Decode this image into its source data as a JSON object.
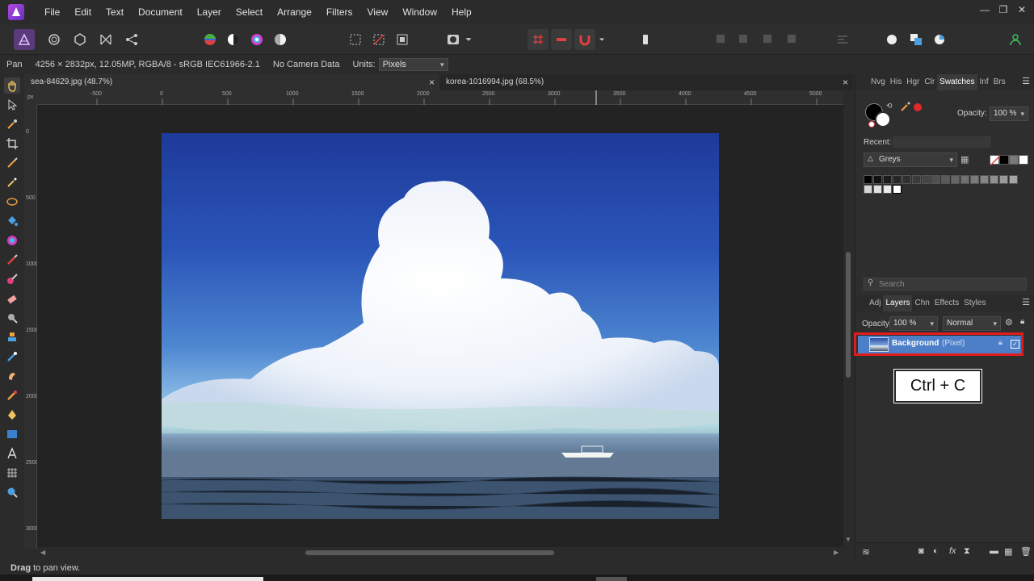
{
  "app": {
    "menu": [
      "File",
      "Edit",
      "Text",
      "Document",
      "Layer",
      "Select",
      "Arrange",
      "Filters",
      "View",
      "Window",
      "Help"
    ]
  },
  "window_controls": {
    "minimize": "—",
    "restore": "❐",
    "close": "✕"
  },
  "contextbar": {
    "tool": "Pan",
    "doc_info": "4256 × 2832px, 12.05MP, RGBA/8 - sRGB IEC61966-2.1",
    "camera": "No Camera Data",
    "units_label": "Units:",
    "units_value": "Pixels"
  },
  "tabs": [
    {
      "label": "sea-84629.jpg (48.7%)",
      "close": "×"
    },
    {
      "label": "korea-1016994.jpg (68.5%)",
      "close": "×"
    }
  ],
  "ruler": {
    "unit": "px",
    "top_ticks": [
      "-500",
      "0",
      "500",
      "1000",
      "1500",
      "2000",
      "2500",
      "3000",
      "3500",
      "4000",
      "4500",
      "5000"
    ],
    "left_ticks": [
      "0",
      "500",
      "1000",
      "1500",
      "2000",
      "2500",
      "3000"
    ]
  },
  "panel_top": {
    "tabs": [
      "Nvg",
      "His",
      "Hgr",
      "Clr",
      "Swatches",
      "Inf",
      "Brs"
    ],
    "active": "Swatches",
    "opacity_label": "Opacity:",
    "opacity_value": "100 %",
    "recent_label": "Recent:",
    "palette": "Greys"
  },
  "search": {
    "placeholder": "Search"
  },
  "panel_layers": {
    "tabs": [
      "Adj",
      "Layers",
      "Chn",
      "Effects",
      "Styles"
    ],
    "active": "Layers",
    "opacity_label": "Opacity:",
    "opacity_value": "100 %",
    "blend_mode": "Normal",
    "layer_name": "Background",
    "layer_type": "(Pixel)"
  },
  "overlay": {
    "shortcut": "Ctrl + C",
    "highlight_color": "#e21b1b"
  },
  "status": {
    "bold": "Drag",
    "text": " to pan view."
  },
  "colors": {
    "accent": "#4d7fc8",
    "bg": "#2b2b2b"
  }
}
